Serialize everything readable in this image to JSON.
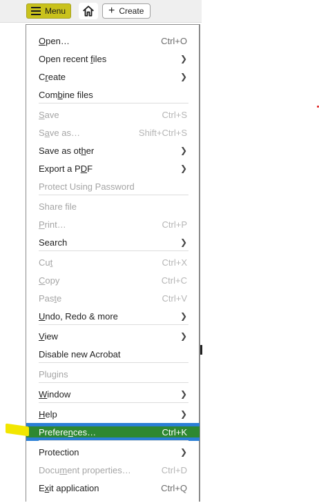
{
  "toolbar": {
    "menu_label": "Menu",
    "create_label": "Create"
  },
  "menu": {
    "items": [
      {
        "pre": "",
        "ul": "O",
        "post": "pen…",
        "shortcut": "Ctrl+O",
        "submenu": false,
        "disabled": false
      },
      {
        "pre": "Open recent ",
        "ul": "f",
        "post": "iles",
        "shortcut": "",
        "submenu": true,
        "disabled": false
      },
      {
        "pre": "C",
        "ul": "r",
        "post": "eate",
        "shortcut": "",
        "submenu": true,
        "disabled": false
      },
      {
        "pre": "Com",
        "ul": "b",
        "post": "ine files",
        "shortcut": "",
        "submenu": false,
        "disabled": false
      },
      {
        "pre": "",
        "ul": "S",
        "post": "ave",
        "shortcut": "Ctrl+S",
        "submenu": false,
        "disabled": true
      },
      {
        "pre": "S",
        "ul": "a",
        "post": "ve as…",
        "shortcut": "Shift+Ctrl+S",
        "submenu": false,
        "disabled": true
      },
      {
        "pre": "Save as ot",
        "ul": "h",
        "post": "er",
        "shortcut": "",
        "submenu": true,
        "disabled": false
      },
      {
        "pre": "Export a P",
        "ul": "D",
        "post": "F",
        "shortcut": "",
        "submenu": true,
        "disabled": false
      },
      {
        "pre": "Protect Using Password",
        "ul": "",
        "post": "",
        "shortcut": "",
        "submenu": false,
        "disabled": true
      },
      {
        "pre": "Share file",
        "ul": "",
        "post": "",
        "shortcut": "",
        "submenu": false,
        "disabled": true
      },
      {
        "pre": "",
        "ul": "P",
        "post": "rint…",
        "shortcut": "Ctrl+P",
        "submenu": false,
        "disabled": true
      },
      {
        "pre": "Search",
        "ul": "",
        "post": "",
        "shortcut": "",
        "submenu": true,
        "disabled": false
      },
      {
        "pre": "Cu",
        "ul": "t",
        "post": "",
        "shortcut": "Ctrl+X",
        "submenu": false,
        "disabled": true
      },
      {
        "pre": "",
        "ul": "C",
        "post": "opy",
        "shortcut": "Ctrl+C",
        "submenu": false,
        "disabled": true
      },
      {
        "pre": "Pas",
        "ul": "t",
        "post": "e",
        "shortcut": "Ctrl+V",
        "submenu": false,
        "disabled": true
      },
      {
        "pre": "",
        "ul": "U",
        "post": "ndo, Redo & more",
        "shortcut": "",
        "submenu": true,
        "disabled": false
      },
      {
        "pre": "",
        "ul": "V",
        "post": "iew",
        "shortcut": "",
        "submenu": true,
        "disabled": false
      },
      {
        "pre": "Disable new Acrobat",
        "ul": "",
        "post": "",
        "shortcut": "",
        "submenu": false,
        "disabled": false
      },
      {
        "pre": "Plugins",
        "ul": "",
        "post": "",
        "shortcut": "",
        "submenu": false,
        "disabled": true
      },
      {
        "pre": "",
        "ul": "W",
        "post": "indow",
        "shortcut": "",
        "submenu": true,
        "disabled": false
      },
      {
        "pre": "",
        "ul": "H",
        "post": "elp",
        "shortcut": "",
        "submenu": true,
        "disabled": false
      },
      {
        "pre": "Prefere",
        "ul": "n",
        "post": "ces…",
        "shortcut": "Ctrl+K",
        "submenu": false,
        "disabled": false
      },
      {
        "pre": "Protection",
        "ul": "",
        "post": "",
        "shortcut": "",
        "submenu": true,
        "disabled": false
      },
      {
        "pre": "Docu",
        "ul": "m",
        "post": "ent properties…",
        "shortcut": "Ctrl+D",
        "submenu": false,
        "disabled": true
      },
      {
        "pre": "E",
        "ul": "x",
        "post": "it application",
        "shortcut": "Ctrl+Q",
        "submenu": false,
        "disabled": false
      }
    ],
    "selected_index": 21
  },
  "colors": {
    "selection_blue": "#2b7fd6",
    "highlight_green": "#2f8a14",
    "marker_yellow": "#f2e600"
  }
}
